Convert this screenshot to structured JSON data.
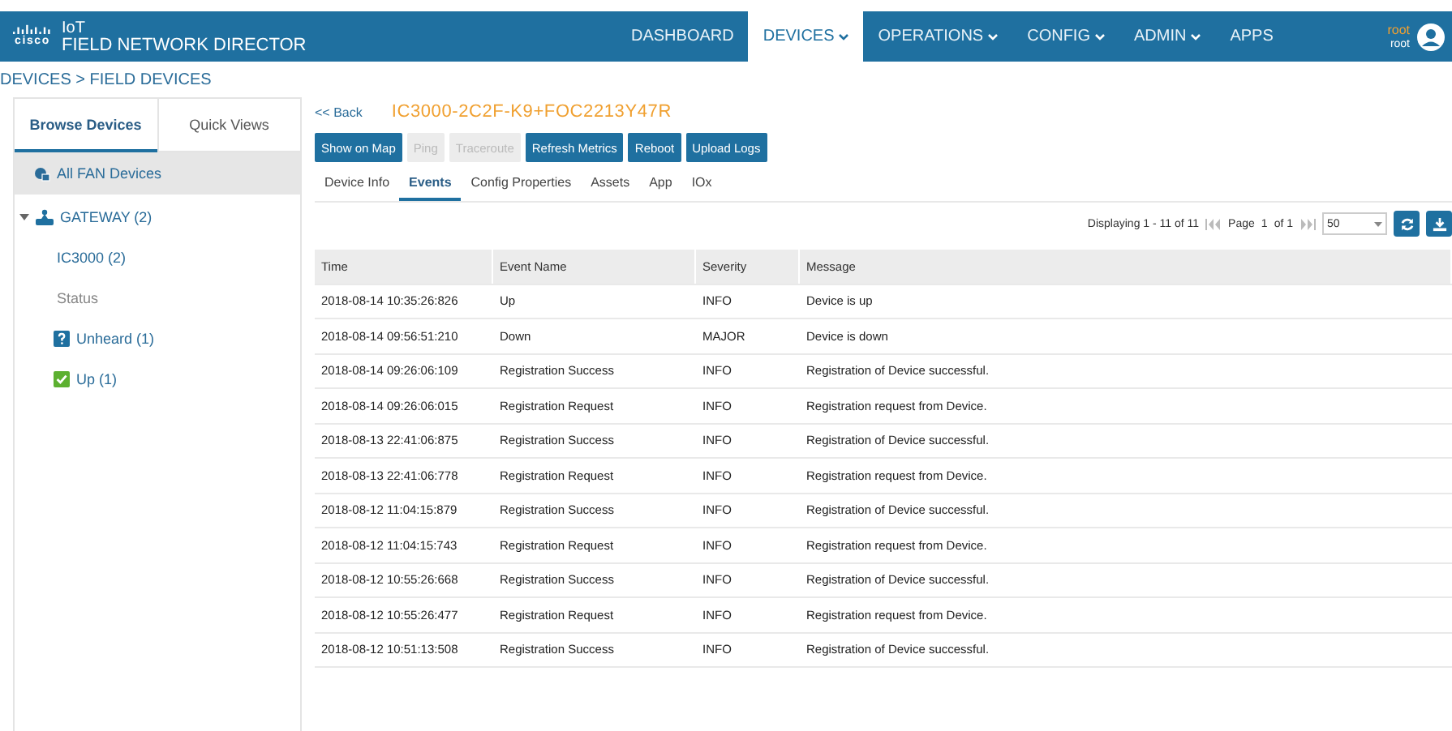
{
  "brand": {
    "logo": "cisco",
    "line1": "IoT",
    "line2": "FIELD NETWORK DIRECTOR"
  },
  "nav": [
    {
      "label": "DASHBOARD",
      "dropdown": false,
      "selected": false
    },
    {
      "label": "DEVICES",
      "dropdown": true,
      "selected": true
    },
    {
      "label": "OPERATIONS",
      "dropdown": true,
      "selected": false
    },
    {
      "label": "CONFIG",
      "dropdown": true,
      "selected": false
    },
    {
      "label": "ADMIN",
      "dropdown": true,
      "selected": false
    },
    {
      "label": "APPS",
      "dropdown": false,
      "selected": false
    }
  ],
  "user": {
    "name": "root",
    "role": "root"
  },
  "breadcrumb": "DEVICES > FIELD DEVICES",
  "sidebar": {
    "tabs": [
      {
        "label": "Browse Devices",
        "selected": true
      },
      {
        "label": "Quick Views",
        "selected": false
      }
    ],
    "all_item": {
      "label": "All FAN Devices",
      "selected": true
    },
    "tree": [
      {
        "label": "GATEWAY (2)",
        "expanded": true,
        "children": [
          {
            "kind": "link",
            "label": "IC3000 (2)"
          },
          {
            "kind": "heading",
            "label": "Status"
          },
          {
            "kind": "unheard",
            "label": "Unheard (1)"
          },
          {
            "kind": "up",
            "label": "Up (1)"
          }
        ]
      }
    ]
  },
  "back": "<< Back",
  "device_title": "IC3000-2C2F-K9+FOC2213Y47R",
  "actions": [
    {
      "label": "Show on Map",
      "disabled": false
    },
    {
      "label": "Ping",
      "disabled": true
    },
    {
      "label": "Traceroute",
      "disabled": true
    },
    {
      "label": "Refresh Metrics",
      "disabled": false
    },
    {
      "label": "Reboot",
      "disabled": false
    },
    {
      "label": "Upload Logs",
      "disabled": false
    }
  ],
  "tabs": [
    {
      "label": "Device Info",
      "selected": false
    },
    {
      "label": "Events",
      "selected": true
    },
    {
      "label": "Config Properties",
      "selected": false
    },
    {
      "label": "Assets",
      "selected": false
    },
    {
      "label": "App",
      "selected": false
    },
    {
      "label": "IOx",
      "selected": false
    }
  ],
  "pager": {
    "summary": "Displaying 1 - 11 of 11",
    "page_label": "Page",
    "page": "1",
    "of": "of 1",
    "page_size": "50"
  },
  "table": {
    "columns": [
      "Time",
      "Event Name",
      "Severity",
      "Message"
    ],
    "rows": [
      [
        "2018-08-14 10:35:26:826",
        "Up",
        "INFO",
        "Device is up"
      ],
      [
        "2018-08-14 09:56:51:210",
        "Down",
        "MAJOR",
        "Device is down"
      ],
      [
        "2018-08-14 09:26:06:109",
        "Registration Success",
        "INFO",
        "Registration of Device successful."
      ],
      [
        "2018-08-14 09:26:06:015",
        "Registration Request",
        "INFO",
        "Registration request from Device."
      ],
      [
        "2018-08-13 22:41:06:875",
        "Registration Success",
        "INFO",
        "Registration of Device successful."
      ],
      [
        "2018-08-13 22:41:06:778",
        "Registration Request",
        "INFO",
        "Registration request from Device."
      ],
      [
        "2018-08-12 11:04:15:879",
        "Registration Success",
        "INFO",
        "Registration of Device successful."
      ],
      [
        "2018-08-12 11:04:15:743",
        "Registration Request",
        "INFO",
        "Registration request from Device."
      ],
      [
        "2018-08-12 10:55:26:668",
        "Registration Success",
        "INFO",
        "Registration of Device successful."
      ],
      [
        "2018-08-12 10:55:26:477",
        "Registration Request",
        "INFO",
        "Registration request from Device."
      ],
      [
        "2018-08-12 10:51:13:508",
        "Registration Success",
        "INFO",
        "Registration of Device successful."
      ]
    ]
  }
}
